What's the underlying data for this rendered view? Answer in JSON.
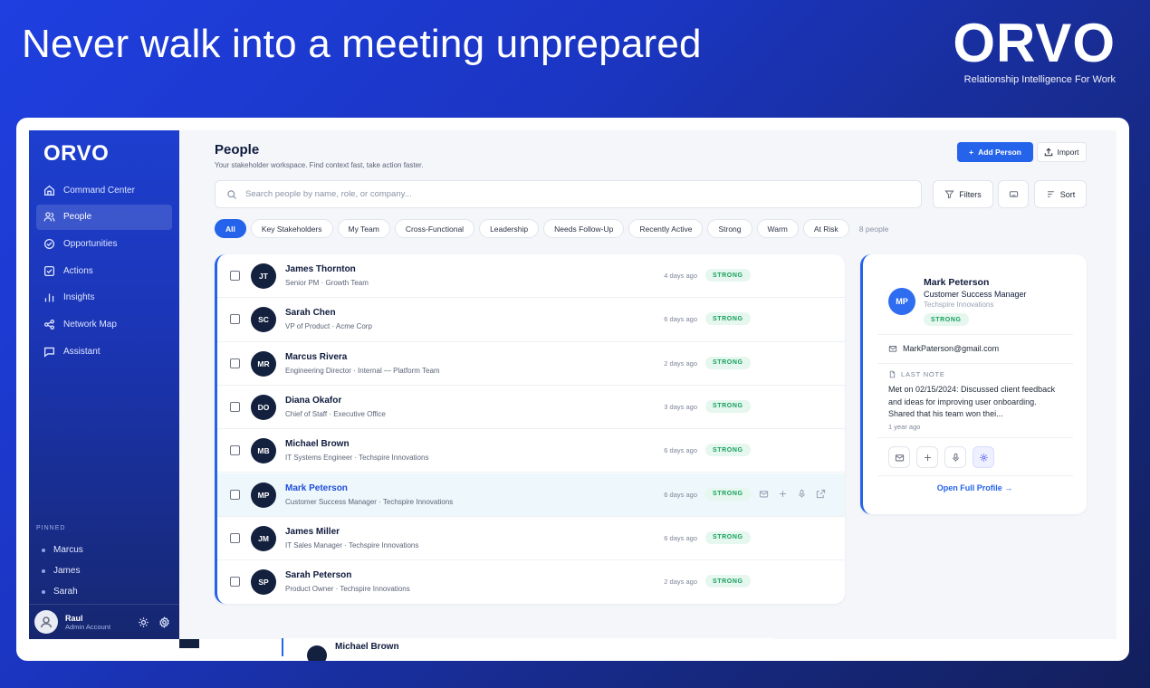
{
  "hero": {
    "headline": "Never walk into a meeting unprepared",
    "brand": "ORVO",
    "tagline": "Relationship Intelligence For Work"
  },
  "sidebar": {
    "logo": "ORVO",
    "items": [
      {
        "label": "Command Center",
        "icon": "home-icon"
      },
      {
        "label": "People",
        "icon": "users-icon",
        "active": true
      },
      {
        "label": "Opportunities",
        "icon": "target-check-icon"
      },
      {
        "label": "Actions",
        "icon": "checkbox-icon"
      },
      {
        "label": "Insights",
        "icon": "bar-chart-icon"
      },
      {
        "label": "Network Map",
        "icon": "share-icon"
      },
      {
        "label": "Assistant",
        "icon": "chat-icon"
      }
    ],
    "pinned_header": "PINNED",
    "pinned": [
      "Marcus",
      "James",
      "Sarah"
    ],
    "user": {
      "name": "Raul",
      "role": "Admin Account"
    }
  },
  "header": {
    "title": "People",
    "subtitle": "Your stakeholder workspace. Find context fast, take action faster.",
    "add_label": "Add Person",
    "import_label": "Import"
  },
  "search": {
    "placeholder": "Search people by name, role, or company...",
    "value": ""
  },
  "toolbar": {
    "filters_label": "Filters",
    "sort_label": "Sort"
  },
  "chips": [
    "All",
    "Key Stakeholders",
    "My Team",
    "Cross-Functional",
    "Leadership",
    "Needs Follow-Up",
    "Recently Active",
    "Strong",
    "Warm",
    "At Risk"
  ],
  "active_chip": "All",
  "people_count": "8 people",
  "people": [
    {
      "initials": "JT",
      "name": "James Thornton",
      "role": "Senior PM · Growth Team",
      "last": "4 days ago",
      "strength": "STRONG"
    },
    {
      "initials": "SC",
      "name": "Sarah Chen",
      "role": "VP of Product · Acme Corp",
      "last": "6 days ago",
      "strength": "STRONG"
    },
    {
      "initials": "MR",
      "name": "Marcus Rivera",
      "role": "Engineering Director · Internal — Platform Team",
      "last": "2 days ago",
      "strength": "STRONG"
    },
    {
      "initials": "DO",
      "name": "Diana Okafor",
      "role": "Chief of Staff · Executive Office",
      "last": "3 days ago",
      "strength": "STRONG"
    },
    {
      "initials": "MB",
      "name": "Michael Brown",
      "role": "IT Systems Engineer · Techspire Innovations",
      "last": "6 days ago",
      "strength": "STRONG"
    },
    {
      "initials": "MP",
      "name": "Mark Peterson",
      "role": "Customer Success Manager · Techspire Innovations",
      "last": "6 days ago",
      "strength": "STRONG",
      "selected": true
    },
    {
      "initials": "JM",
      "name": "James Miller",
      "role": "IT Sales Manager · Techspire Innovations",
      "last": "6 days ago",
      "strength": "STRONG"
    },
    {
      "initials": "SP",
      "name": "Sarah Peterson",
      "role": "Product Owner · Techspire Innovations",
      "last": "2 days ago",
      "strength": "STRONG"
    }
  ],
  "detail": {
    "initials": "MP",
    "name": "Mark Peterson",
    "role": "Customer Success Manager",
    "company": "Techspire Innovations",
    "strength": "STRONG",
    "email": "MarkPaterson@gmail.com",
    "note_header": "LAST NOTE",
    "note": "Met on 02/15/2024: Discussed client feedback and ideas for improving user onboarding. Shared that his team won thei...",
    "note_age": "1 year ago",
    "open_label": "Open Full Profile →"
  },
  "ghost_row": {
    "name": "Michael Brown"
  },
  "colors": {
    "accent": "#2563eb",
    "sidebar": "#1d3fcf",
    "strong_bg": "#e5f7ee",
    "strong_fg": "#16a05d",
    "avatar": "#13213f"
  }
}
